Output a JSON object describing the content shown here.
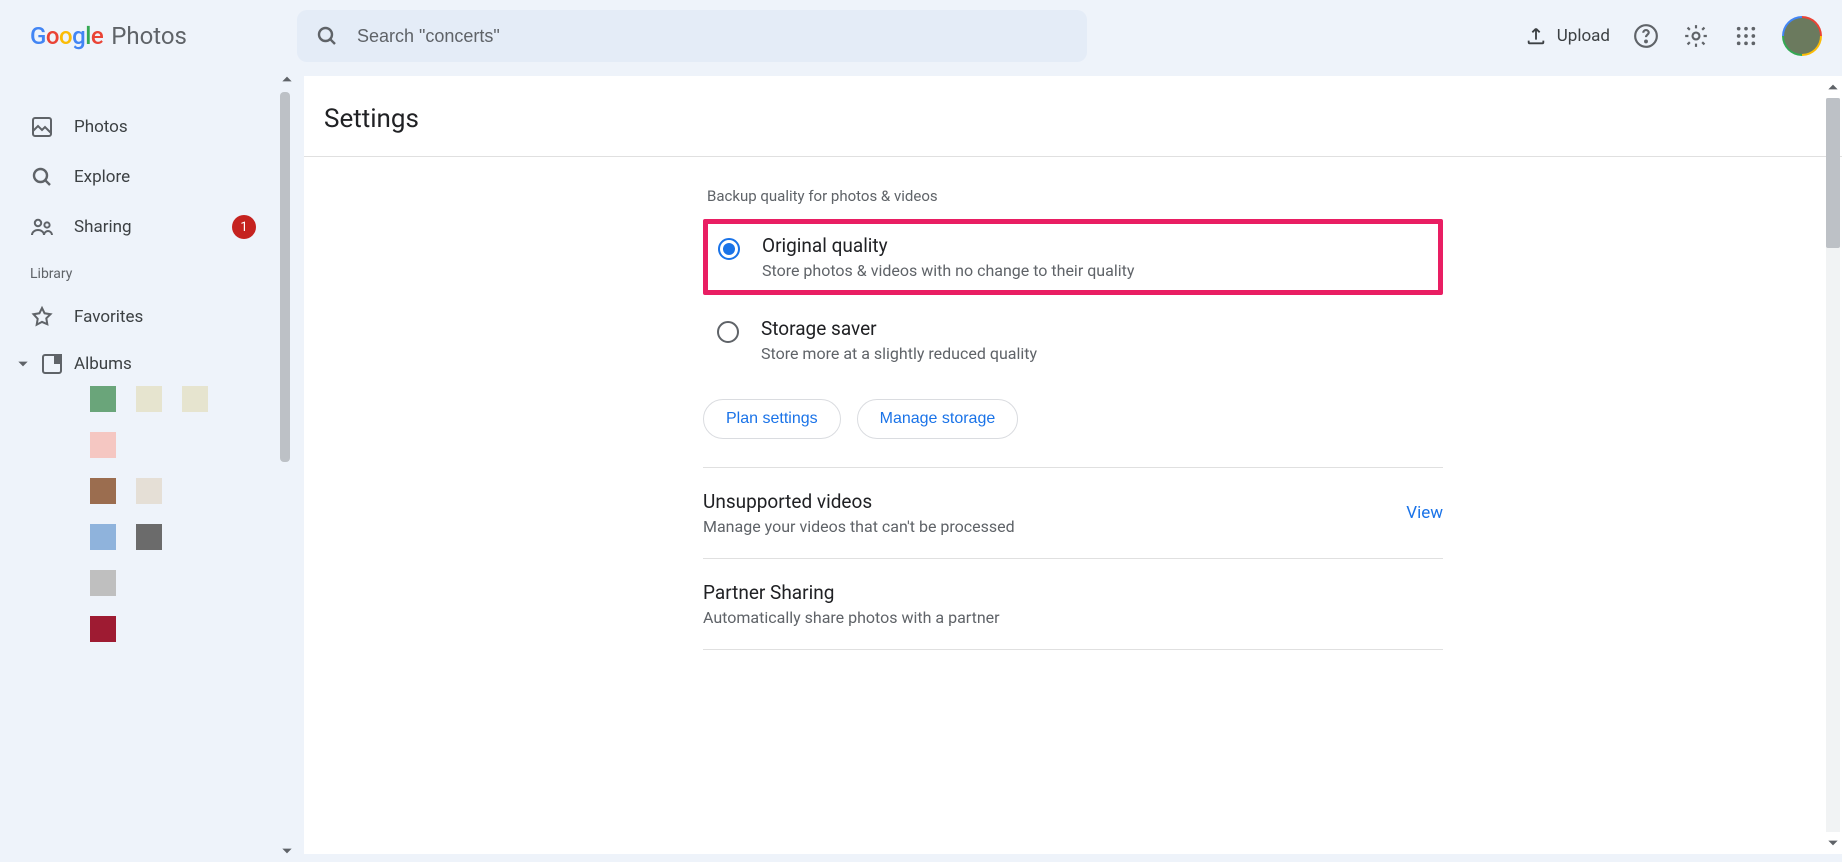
{
  "brand": {
    "product": "Photos"
  },
  "search": {
    "placeholder": "Search \"concerts\""
  },
  "header": {
    "upload": "Upload"
  },
  "sidebar": {
    "photos": "Photos",
    "explore": "Explore",
    "sharing": "Sharing",
    "sharing_badge": "1",
    "library_label": "Library",
    "favorites": "Favorites",
    "albums": "Albums",
    "album_thumb_colors": [
      [
        "#6aa57a",
        "#e6e4cf",
        "#e6e4cf"
      ],
      [
        "#f5c7c2"
      ],
      [
        "#9b6d4f",
        "#e5dfd6"
      ],
      [
        "#8fb3dc",
        "#6b6b6b"
      ],
      [
        "#bfbfbf"
      ],
      [
        "#9e1b32"
      ]
    ]
  },
  "settings": {
    "title": "Settings",
    "backup_label": "Backup quality for photos & videos",
    "options": [
      {
        "title": "Original quality",
        "desc": "Store photos & videos with no change to their quality",
        "checked": true,
        "highlighted": true
      },
      {
        "title": "Storage saver",
        "desc": "Store more at a slightly reduced quality",
        "checked": false,
        "highlighted": false
      }
    ],
    "plan_btn": "Plan settings",
    "manage_btn": "Manage storage",
    "unsupported_title": "Unsupported videos",
    "unsupported_desc": "Manage your videos that can't be processed",
    "view": "View",
    "partner_title": "Partner Sharing",
    "partner_desc": "Automatically share photos with a partner"
  }
}
